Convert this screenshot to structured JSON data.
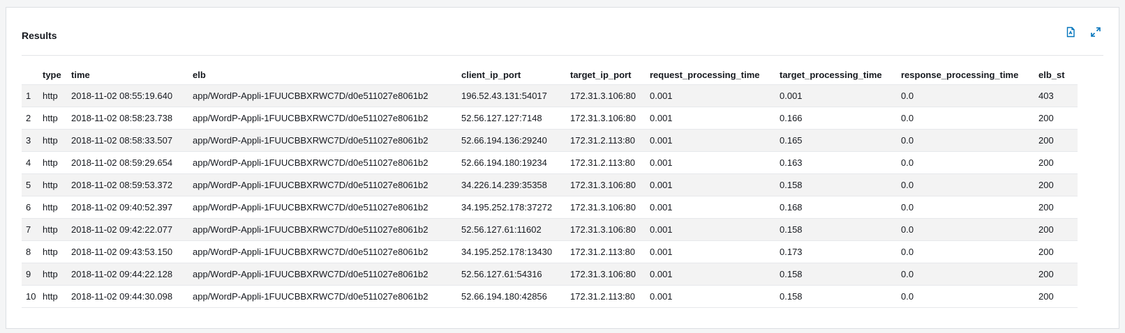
{
  "panel": {
    "title": "Results",
    "icons": {
      "export": "export-pdf-icon",
      "fullscreen": "expand-icon"
    }
  },
  "table": {
    "columns": [
      "",
      "type",
      "time",
      "elb",
      "client_ip_port",
      "target_ip_port",
      "request_processing_time",
      "target_processing_time",
      "response_processing_time",
      "elb_st"
    ],
    "rows": [
      [
        "1",
        "http",
        "2018-11-02 08:55:19.640",
        "app/WordP-Appli-1FUUCBBXRWC7D/d0e511027e8061b2",
        "196.52.43.131:54017",
        "172.31.3.106:80",
        "0.001",
        "0.001",
        "0.0",
        "403"
      ],
      [
        "2",
        "http",
        "2018-11-02 08:58:23.738",
        "app/WordP-Appli-1FUUCBBXRWC7D/d0e511027e8061b2",
        "52.56.127.127:7148",
        "172.31.3.106:80",
        "0.001",
        "0.166",
        "0.0",
        "200"
      ],
      [
        "3",
        "http",
        "2018-11-02 08:58:33.507",
        "app/WordP-Appli-1FUUCBBXRWC7D/d0e511027e8061b2",
        "52.66.194.136:29240",
        "172.31.2.113:80",
        "0.001",
        "0.165",
        "0.0",
        "200"
      ],
      [
        "4",
        "http",
        "2018-11-02 08:59:29.654",
        "app/WordP-Appli-1FUUCBBXRWC7D/d0e511027e8061b2",
        "52.66.194.180:19234",
        "172.31.2.113:80",
        "0.001",
        "0.163",
        "0.0",
        "200"
      ],
      [
        "5",
        "http",
        "2018-11-02 08:59:53.372",
        "app/WordP-Appli-1FUUCBBXRWC7D/d0e511027e8061b2",
        "34.226.14.239:35358",
        "172.31.3.106:80",
        "0.001",
        "0.158",
        "0.0",
        "200"
      ],
      [
        "6",
        "http",
        "2018-11-02 09:40:52.397",
        "app/WordP-Appli-1FUUCBBXRWC7D/d0e511027e8061b2",
        "34.195.252.178:37272",
        "172.31.3.106:80",
        "0.001",
        "0.168",
        "0.0",
        "200"
      ],
      [
        "7",
        "http",
        "2018-11-02 09:42:22.077",
        "app/WordP-Appli-1FUUCBBXRWC7D/d0e511027e8061b2",
        "52.56.127.61:11602",
        "172.31.3.106:80",
        "0.001",
        "0.158",
        "0.0",
        "200"
      ],
      [
        "8",
        "http",
        "2018-11-02 09:43:53.150",
        "app/WordP-Appli-1FUUCBBXRWC7D/d0e511027e8061b2",
        "34.195.252.178:13430",
        "172.31.2.113:80",
        "0.001",
        "0.173",
        "0.0",
        "200"
      ],
      [
        "9",
        "http",
        "2018-11-02 09:44:22.128",
        "app/WordP-Appli-1FUUCBBXRWC7D/d0e511027e8061b2",
        "52.56.127.61:54316",
        "172.31.3.106:80",
        "0.001",
        "0.158",
        "0.0",
        "200"
      ],
      [
        "10",
        "http",
        "2018-11-02 09:44:30.098",
        "app/WordP-Appli-1FUUCBBXRWC7D/d0e511027e8061b2",
        "52.66.194.180:42856",
        "172.31.2.113:80",
        "0.001",
        "0.158",
        "0.0",
        "200"
      ]
    ]
  },
  "colors": {
    "accent": "#0073bb",
    "stripe": "#f3f3f3"
  }
}
